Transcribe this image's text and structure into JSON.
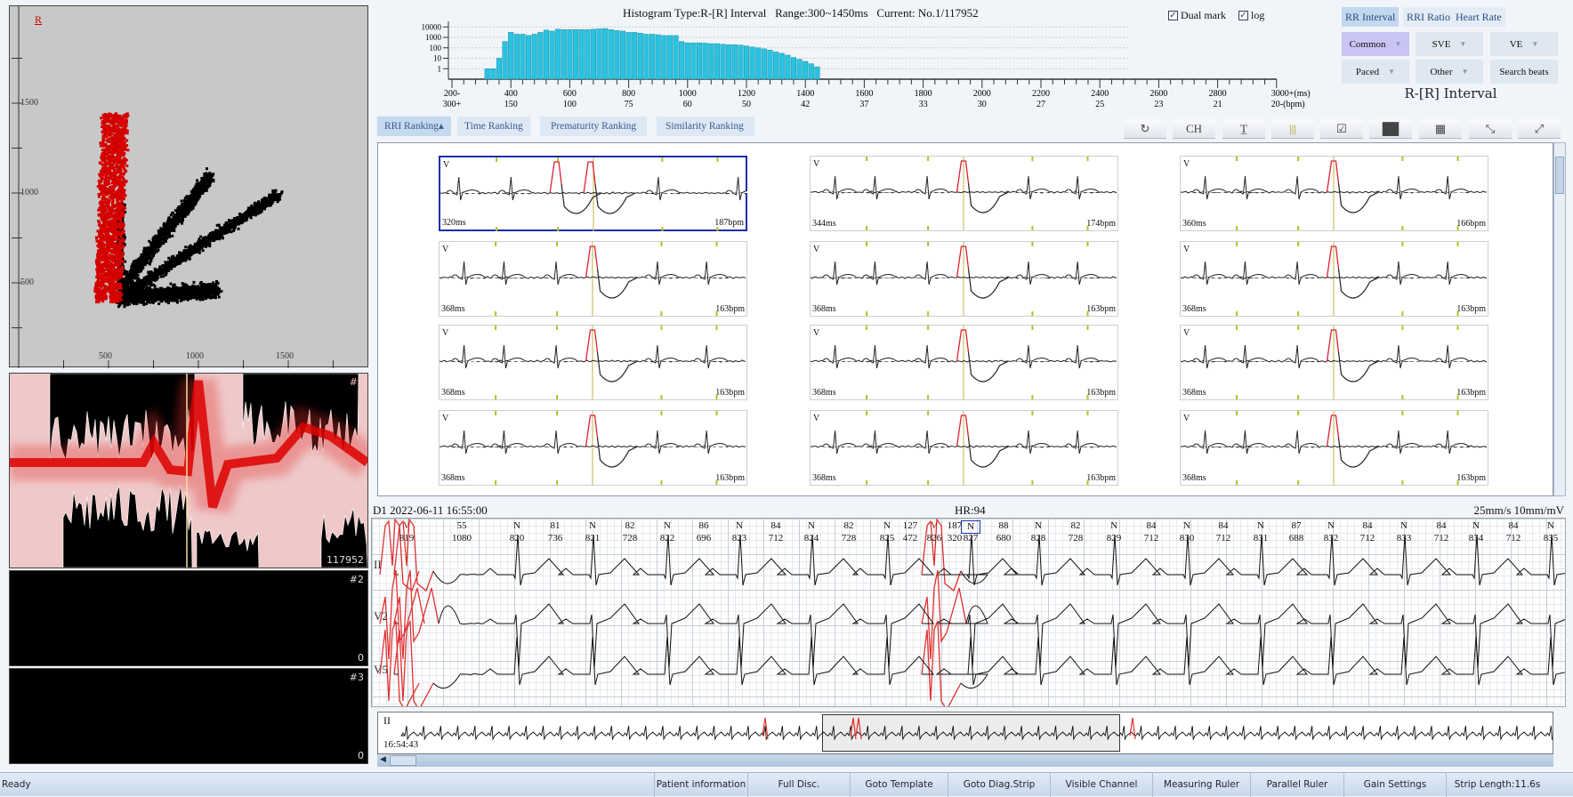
{
  "scatter": {
    "axis_label": "R",
    "y_ticks": [
      "1500",
      "1000",
      "500"
    ],
    "x_ticks": [
      "500",
      "1000",
      "1500"
    ],
    "colors": {
      "ventricular": "#d40000",
      "normal": "#000000",
      "background": "#c8c8c8"
    }
  },
  "channels": [
    {
      "lead": "II",
      "id": "#1",
      "count": "117952"
    },
    {
      "id": "#2",
      "count": "0"
    },
    {
      "id": "#3",
      "count": "0"
    }
  ],
  "histogram": {
    "title": "Histogram Type:R-[R] Interval   Range:300~1450ms   Current: No.1/117952",
    "dual_mark": {
      "label": "Dual mark",
      "checked": true
    },
    "log": {
      "label": "log",
      "checked": true
    },
    "y_ticks": [
      "10000",
      "1000",
      "100",
      "10",
      "1"
    ],
    "x_ticks_ms": [
      "200-",
      "400",
      "600",
      "800",
      "1000",
      "1200",
      "1400",
      "1600",
      "1800",
      "2000",
      "2200",
      "2400",
      "2600",
      "2800",
      "3000+(ms)"
    ],
    "x_ticks_bpm": [
      "300+",
      "150",
      "100",
      "75",
      "60",
      "50",
      "42",
      "37",
      "33",
      "30",
      "27",
      "25",
      "23",
      "21",
      "20-(bpm)"
    ],
    "bar_color": "#29c3e0",
    "bin_start_ms": 320,
    "bin_step_ms": 20,
    "counts": [
      1,
      1,
      10,
      400,
      3000,
      2000,
      2000,
      1500,
      2000,
      3000,
      5000,
      4000,
      6000,
      5500,
      5500,
      5500,
      5500,
      5500,
      6000,
      6500,
      7000,
      5500,
      4500,
      4000,
      3000,
      3000,
      2500,
      2000,
      2000,
      1800,
      1500,
      1500,
      1500,
      400,
      300,
      300,
      300,
      280,
      250,
      250,
      220,
      200,
      200,
      180,
      150,
      120,
      100,
      80,
      60,
      40,
      30,
      20,
      12,
      8,
      5,
      3,
      1.5
    ]
  },
  "right_panel": {
    "tabs": [
      {
        "label": "RR Interval",
        "selected": true
      },
      {
        "label": "RRI Ratio"
      },
      {
        "label": "Heart Rate"
      }
    ],
    "buttons": [
      {
        "label": "Common",
        "dropdown": true,
        "selected": true
      },
      {
        "label": "SVE",
        "dropdown": true
      },
      {
        "label": "VE",
        "dropdown": true
      },
      {
        "label": "Paced",
        "dropdown": true
      },
      {
        "label": "Other",
        "dropdown": true
      },
      {
        "label": "Search beats",
        "dropdown": false
      }
    ],
    "title": "R-[R] Interval"
  },
  "ranking_tabs": [
    {
      "label": "RRI Ranking▴",
      "selected": true
    },
    {
      "label": "Time Ranking"
    },
    {
      "label": "Prematurity Ranking"
    },
    {
      "label": "Similarity Ranking"
    }
  ],
  "toolbar": [
    {
      "icon": "refresh-icon",
      "glyph": "↻"
    },
    {
      "icon": "channel-icon",
      "glyph": "CH"
    },
    {
      "icon": "text-icon",
      "glyph": "T̲"
    },
    {
      "icon": "marker-lines-icon",
      "glyph": "|||"
    },
    {
      "icon": "clipboard-check-icon",
      "glyph": "☑"
    },
    {
      "icon": "grid-layout-icon",
      "glyph": "██"
    },
    {
      "icon": "grid-alt-icon",
      "glyph": "▦"
    },
    {
      "icon": "collapse-icon",
      "glyph": "⤡"
    },
    {
      "icon": "expand-icon",
      "glyph": "⤢"
    }
  ],
  "templates": [
    {
      "type": "V",
      "interval": "320ms",
      "rate": "187bpm"
    },
    {
      "type": "V",
      "interval": "344ms",
      "rate": "174bpm"
    },
    {
      "type": "V",
      "interval": "360ms",
      "rate": "166bpm"
    },
    {
      "type": "V",
      "interval": "368ms",
      "rate": "163bpm"
    },
    {
      "type": "V",
      "interval": "368ms",
      "rate": "163bpm"
    },
    {
      "type": "V",
      "interval": "368ms",
      "rate": "163bpm"
    },
    {
      "type": "V",
      "interval": "368ms",
      "rate": "163bpm"
    },
    {
      "type": "V",
      "interval": "368ms",
      "rate": "163bpm"
    },
    {
      "type": "V",
      "interval": "368ms",
      "rate": "163bpm"
    },
    {
      "type": "V",
      "interval": "368ms",
      "rate": "163bpm"
    },
    {
      "type": "V",
      "interval": "368ms",
      "rate": "163bpm"
    },
    {
      "type": "V",
      "interval": "368ms",
      "rate": "163bpm"
    }
  ],
  "strip": {
    "header_left": "D1 2022-06-11 16:55:00",
    "heart_rate": "HR:94",
    "scale": "25mm/s 10mm/mV",
    "leads": [
      "II",
      "V2",
      "V5"
    ],
    "beats": [
      {
        "type": "V",
        "no": "819"
      },
      {
        "type": "N",
        "no": "820"
      },
      {
        "type": "N",
        "no": "821"
      },
      {
        "type": "N",
        "no": "822"
      },
      {
        "type": "N",
        "no": "823"
      },
      {
        "type": "N",
        "no": "824"
      },
      {
        "type": "N",
        "no": "825"
      },
      {
        "type": "V",
        "no": "826"
      },
      {
        "type": "N",
        "no": "827",
        "selected": true
      },
      {
        "type": "N",
        "no": "828"
      },
      {
        "type": "N",
        "no": "829"
      },
      {
        "type": "N",
        "no": "830"
      },
      {
        "type": "N",
        "no": "831"
      },
      {
        "type": "N",
        "no": "832"
      },
      {
        "type": "N",
        "no": "833"
      },
      {
        "type": "N",
        "no": "834"
      },
      {
        "type": "N",
        "no": "835"
      }
    ],
    "intervals": [
      {
        "hr": "55",
        "ms": "1080"
      },
      {
        "hr": "81",
        "ms": "736"
      },
      {
        "hr": "82",
        "ms": "728"
      },
      {
        "hr": "86",
        "ms": "696"
      },
      {
        "hr": "84",
        "ms": "712"
      },
      {
        "hr": "82",
        "ms": "728"
      },
      {
        "hr": "127",
        "ms": "472"
      },
      {
        "hr": "187",
        "ms": "320"
      },
      {
        "hr": "88",
        "ms": "680"
      },
      {
        "hr": "82",
        "ms": "728"
      },
      {
        "hr": "84",
        "ms": "712"
      },
      {
        "hr": "84",
        "ms": "712"
      },
      {
        "hr": "87",
        "ms": "688"
      },
      {
        "hr": "84",
        "ms": "712"
      },
      {
        "hr": "84",
        "ms": "712"
      },
      {
        "hr": "84",
        "ms": "712"
      }
    ],
    "ventricular_color": "#e03030"
  },
  "overview": {
    "lead": "II",
    "time": "16:54:43"
  },
  "status": {
    "text": "Ready",
    "buttons": [
      "Patient information",
      "Full Disc.",
      "Goto Template",
      "Goto Diag.Strip",
      "Visible Channel",
      "Measuring Ruler",
      "Parallel Ruler",
      "Gain Settings",
      "Strip Length:11.6s"
    ]
  }
}
